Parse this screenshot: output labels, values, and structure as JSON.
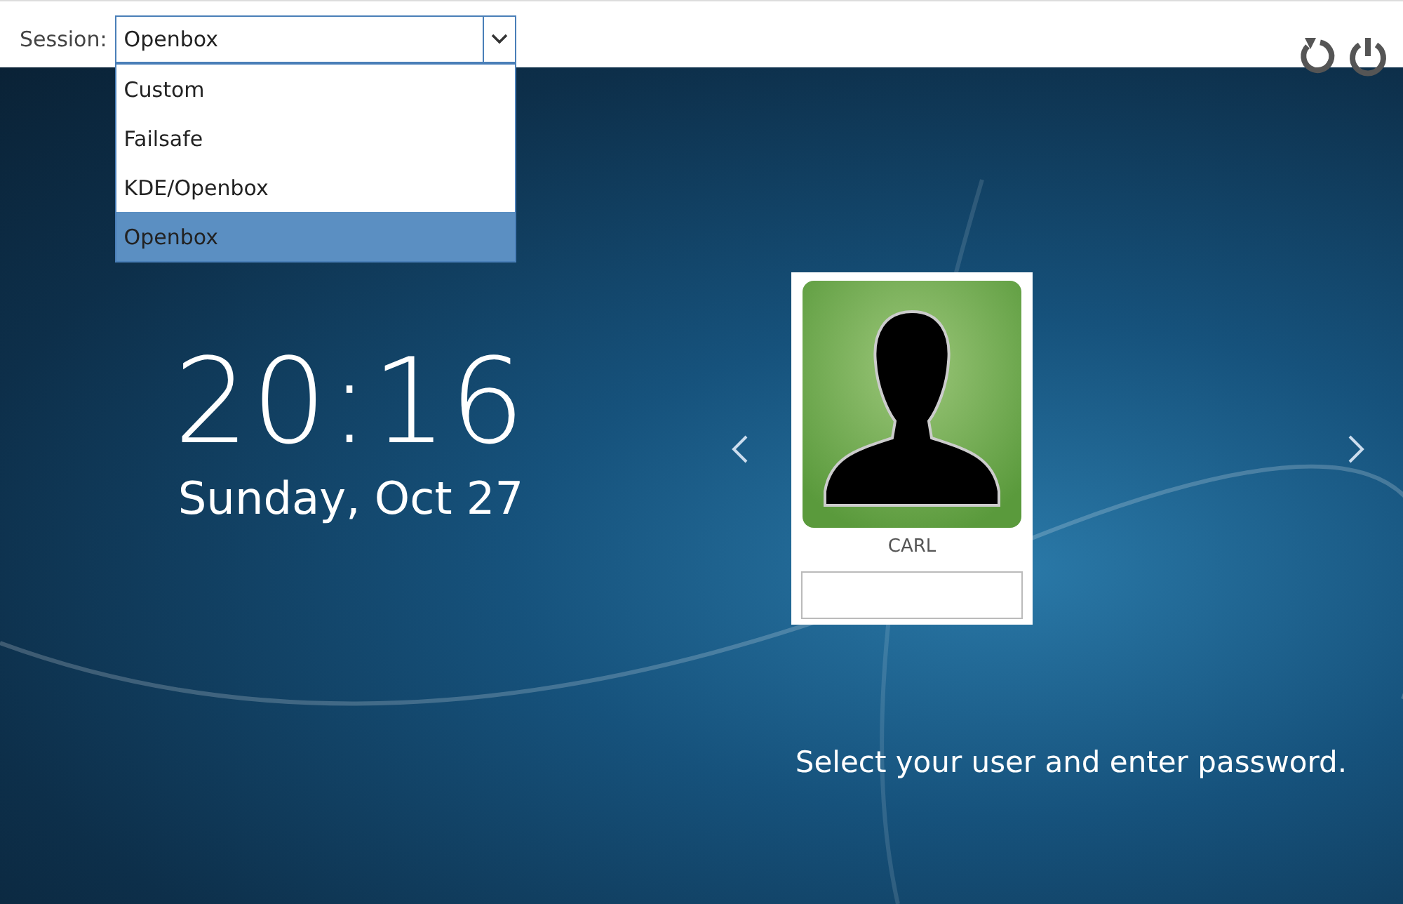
{
  "session": {
    "label": "Session:",
    "value": "Openbox",
    "expanded": true,
    "options": [
      {
        "label": "Custom",
        "selected": false
      },
      {
        "label": "Failsafe",
        "selected": false
      },
      {
        "label": "KDE/Openbox",
        "selected": false
      },
      {
        "label": "Openbox",
        "selected": true
      }
    ]
  },
  "clock": {
    "time": "20:16",
    "date": "Sunday, Oct 27"
  },
  "user": {
    "name": "CARL"
  },
  "message": "Select your user and enter password."
}
